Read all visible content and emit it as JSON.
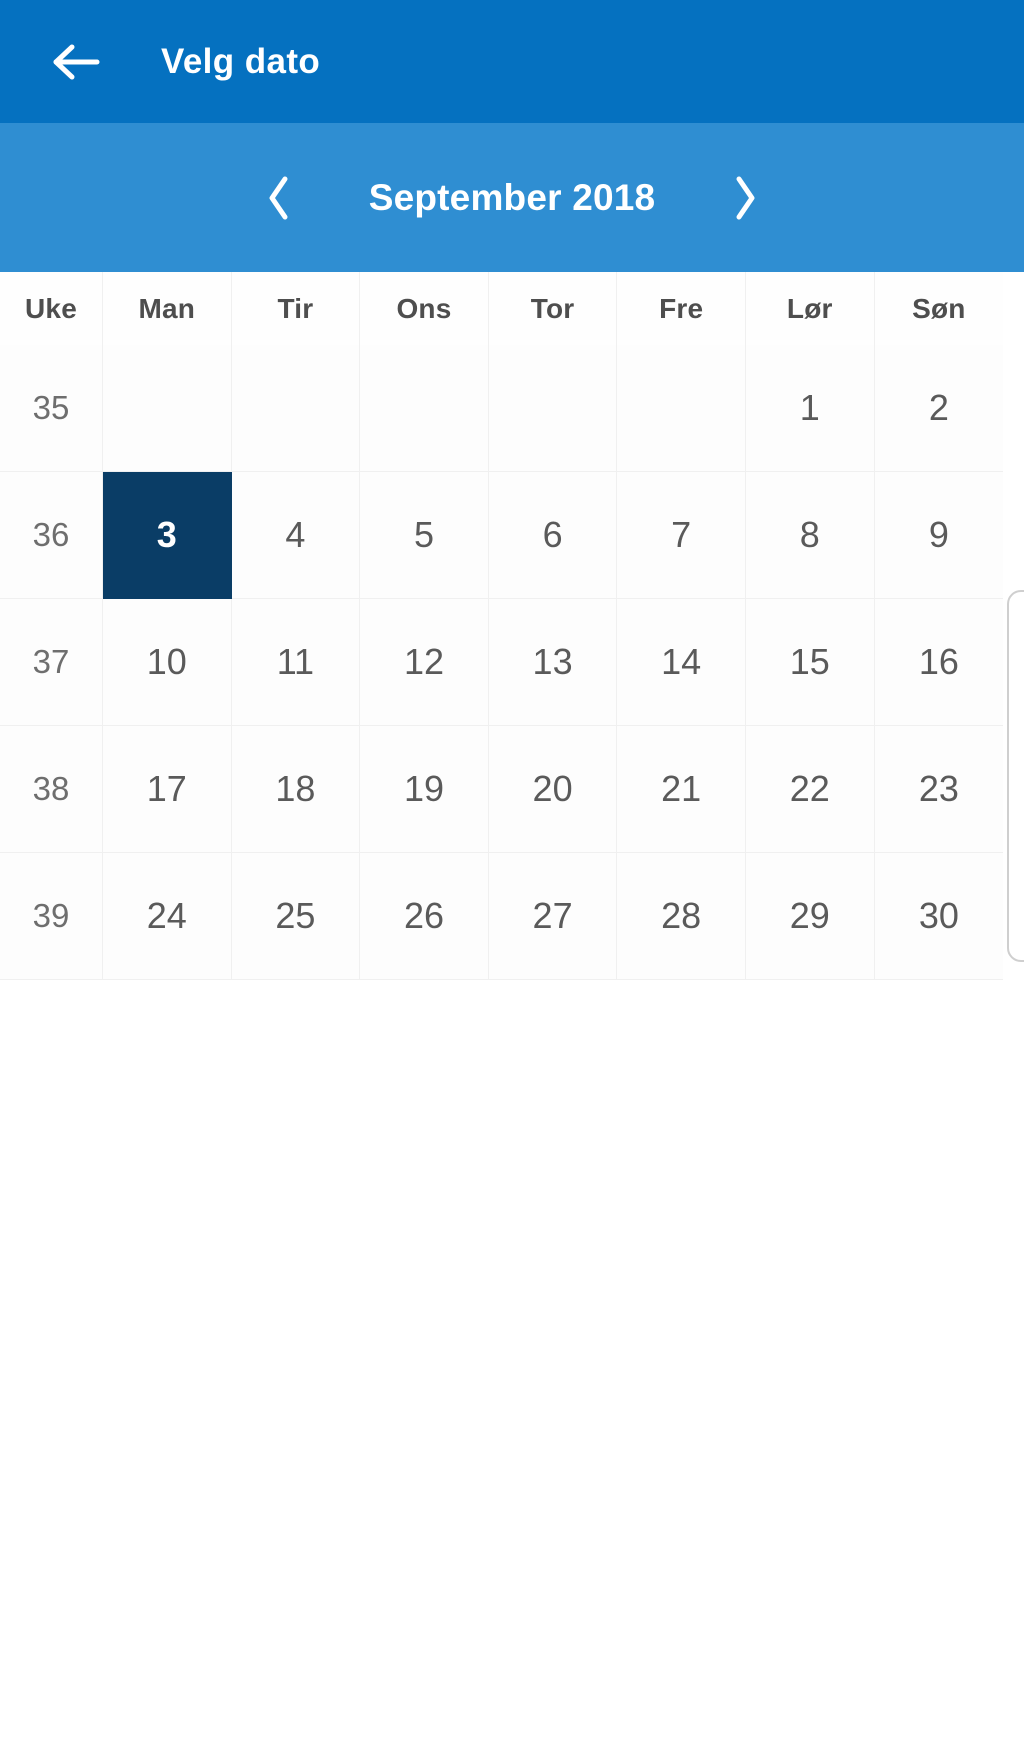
{
  "app_bar": {
    "back_icon": "arrow-left-icon",
    "title": "Velg dato",
    "background_color": "#0571c0"
  },
  "month_nav": {
    "prev_icon": "chevron-left-icon",
    "next_icon": "chevron-right-icon",
    "label": "September 2018",
    "month": "September",
    "year": "2018",
    "background_color": "#2f8ed2"
  },
  "calendar": {
    "column_headers": [
      "Uke",
      "Man",
      "Tir",
      "Ons",
      "Tor",
      "Fre",
      "Lør",
      "Søn"
    ],
    "selected_day": "3",
    "selected_color": "#0a3d66",
    "day_text_color": "#5a5a5a",
    "weeks": [
      {
        "week_number": "35",
        "days": [
          "",
          "",
          "",
          "",
          "",
          "1",
          "2"
        ]
      },
      {
        "week_number": "36",
        "days": [
          "3",
          "4",
          "5",
          "6",
          "7",
          "8",
          "9"
        ]
      },
      {
        "week_number": "37",
        "days": [
          "10",
          "11",
          "12",
          "13",
          "14",
          "15",
          "16"
        ]
      },
      {
        "week_number": "38",
        "days": [
          "17",
          "18",
          "19",
          "20",
          "21",
          "22",
          "23"
        ]
      },
      {
        "week_number": "39",
        "days": [
          "24",
          "25",
          "26",
          "27",
          "28",
          "29",
          "30"
        ]
      }
    ]
  }
}
